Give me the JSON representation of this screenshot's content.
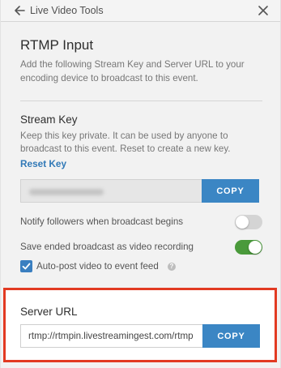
{
  "header": {
    "title": "Live Video Tools"
  },
  "rtmp": {
    "title": "RTMP Input",
    "description": "Add the following Stream Key and Server URL to your encoding device to broadcast to this event."
  },
  "stream_key": {
    "title": "Stream Key",
    "description": "Keep this key private. It can be used by anyone to broadcast to this event. Reset to create a new key.",
    "reset_label": "Reset Key",
    "copy_label": "COPY"
  },
  "options": {
    "notify_label": "Notify followers when broadcast begins",
    "notify_on": false,
    "save_label": "Save ended broadcast as video recording",
    "save_on": true,
    "autopost_label": "Auto-post video to event feed",
    "autopost_checked": true,
    "info_glyph": "?"
  },
  "server_url": {
    "title": "Server URL",
    "value": "rtmp://rtmpin.livestreamingest.com/rtmp",
    "copy_label": "COPY"
  },
  "colors": {
    "accent_blue": "#3b86c4",
    "toggle_on_green": "#4a9a3b",
    "highlight_red": "#e23a22"
  }
}
